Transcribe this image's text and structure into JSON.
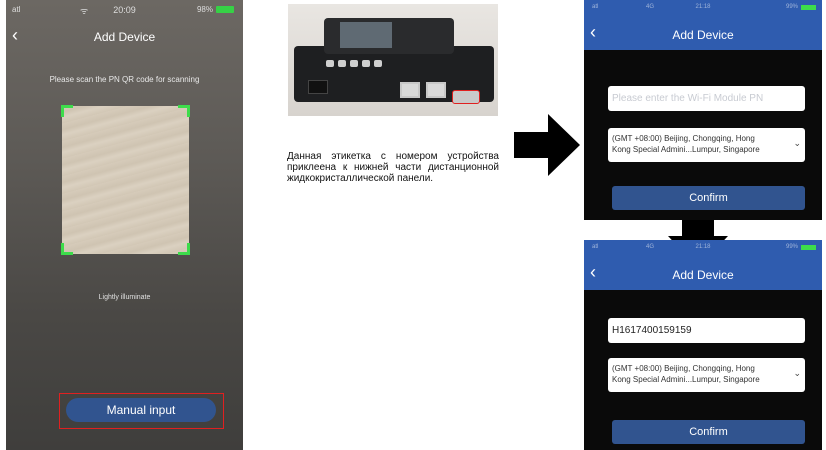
{
  "scan_screen": {
    "status": {
      "signal": "atl",
      "wifi": "ᯤ",
      "time": "20:09",
      "battery": "98%"
    },
    "back_icon": "chevron-left-icon",
    "title": "Add Device",
    "hint": "Please scan the PN QR code for scanning",
    "illuminate": "Lightly illuminate",
    "manual_input_label": "Manual input",
    "frame_color": "#3ddc4b",
    "highlight_color": "#e02020"
  },
  "device_caption": "Данная этикетка с номером устройства приклеена к нижней части дистанционной жидкокристаллической панели.",
  "manual_screen_empty": {
    "status": {
      "signal": "atl",
      "network": "4G",
      "time": "21:18",
      "battery": "99%"
    },
    "title": "Add Device",
    "pn_placeholder": "Please enter the Wi-Fi Module PN",
    "timezone_line1": "(GMT +08:00) Beijing, Chongqing, Hong",
    "timezone_line2": "Kong Special Admini...Lumpur, Singapore",
    "confirm_label": "Confirm"
  },
  "manual_screen_filled": {
    "status": {
      "signal": "atl",
      "network": "4G",
      "time": "21:18",
      "battery": "99%"
    },
    "title": "Add Device",
    "pn_value": "H1617400159159",
    "timezone_line1": "(GMT +08:00) Beijing, Chongqing, Hong",
    "timezone_line2": "Kong Special Admini...Lumpur, Singapore",
    "confirm_label": "Confirm"
  },
  "colors": {
    "header_blue": "#2f5caf",
    "button_blue": "#31548f",
    "accent_green": "#3ddc4b"
  }
}
